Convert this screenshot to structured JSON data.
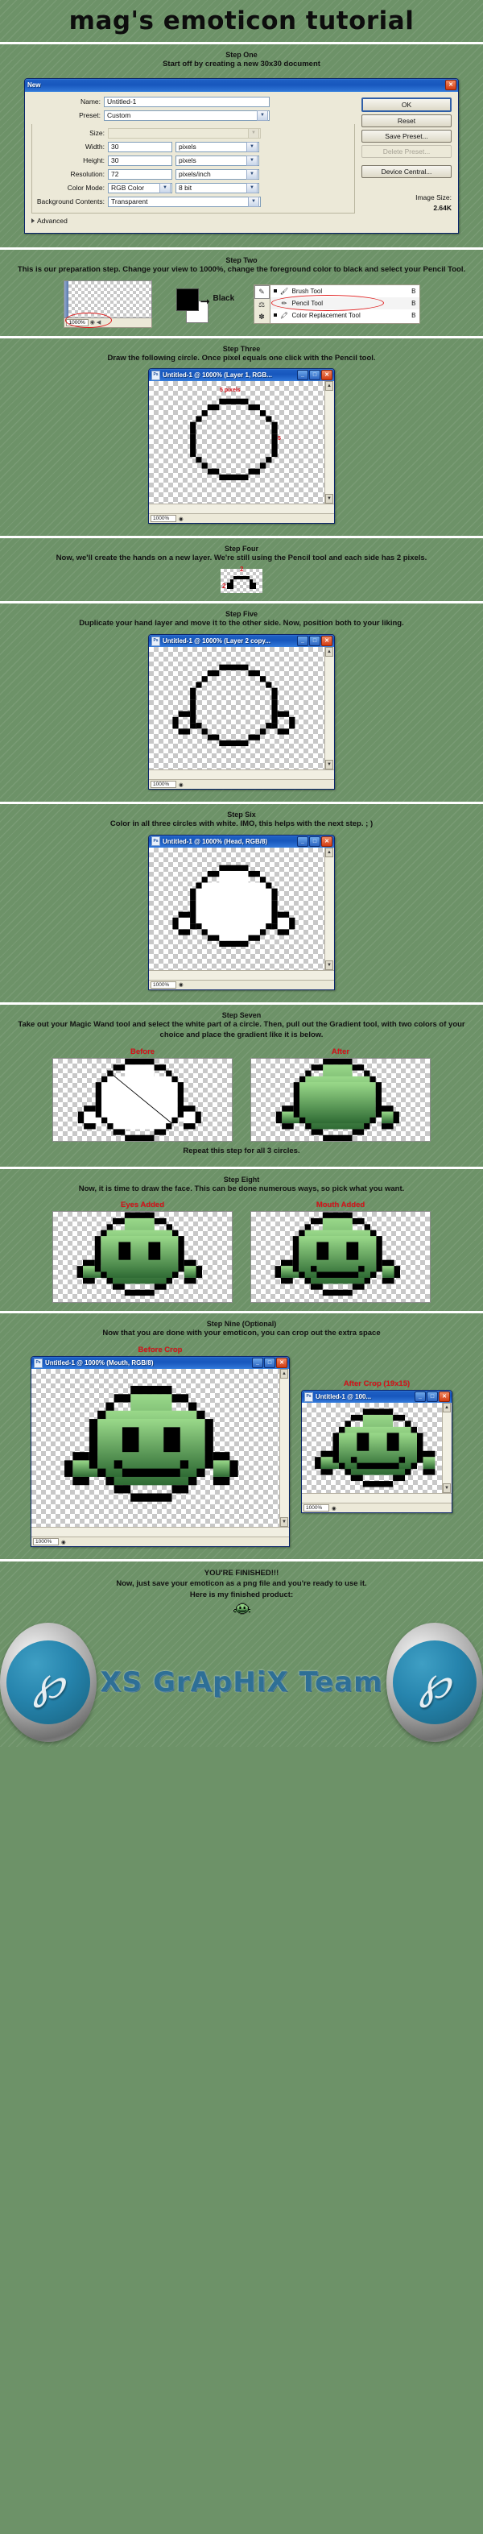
{
  "header": {
    "title": "mag's emoticon tutorial"
  },
  "steps": [
    {
      "id": "step-one",
      "title": "Step One",
      "desc": "Start off by creating a new 30x30 document",
      "dialog": {
        "title": "New",
        "close_label": "✕",
        "fields": {
          "name_label": "Name:",
          "name_value": "Untitled-1",
          "preset_label": "Preset:",
          "preset_value": "Custom",
          "size_label": "Size:",
          "size_value": "",
          "width_label": "Width:",
          "width_value": "30",
          "width_unit": "pixels",
          "height_label": "Height:",
          "height_value": "30",
          "height_unit": "pixels",
          "resolution_label": "Resolution:",
          "resolution_value": "72",
          "resolution_unit": "pixels/inch",
          "colormode_label": "Color Mode:",
          "colormode_value": "RGB Color",
          "colordepth_value": "8 bit",
          "bgcontents_label": "Background Contents:",
          "bgcontents_value": "Transparent",
          "advanced_label": "Advanced"
        },
        "buttons": {
          "ok": "OK",
          "reset": "Reset",
          "save_preset": "Save Preset...",
          "delete_preset": "Delete Preset...",
          "device_central": "Device Central..."
        },
        "image_size_label": "Image Size:",
        "image_size_value": "2.64K"
      }
    },
    {
      "id": "step-two",
      "title": "Step Two",
      "desc": "This is our preparation step.  Change your view to 1000%, change the foreground color to black and select your Pencil Tool.",
      "zoom_value": "1000%",
      "swatch_label": "Black",
      "tools": [
        {
          "label": "Brush Tool",
          "key": "B",
          "selected": false
        },
        {
          "label": "Pencil Tool",
          "key": "B",
          "selected": true
        },
        {
          "label": "Color Replacement Tool",
          "key": "B",
          "selected": false
        }
      ]
    },
    {
      "id": "step-three",
      "title": "Step Three",
      "desc": "Draw the following circle.  Once pixel equals one click with the Pencil tool.",
      "window_title": "Untitled-1 @ 1000% (Layer 1, RGB...",
      "zoom_value": "1000%",
      "annotation_top": "5 pixels",
      "annotation_right": "5"
    },
    {
      "id": "step-four",
      "title": "Step Four",
      "desc": "Now, we'll create the hands on a new layer.  We're still using the Pencil tool and each side has 2 pixels.",
      "annotation_top": "2",
      "annotation_left": "2"
    },
    {
      "id": "step-five",
      "title": "Step Five",
      "desc": "Duplicate your hand layer and move it to the other side.  Now, position both to your liking.",
      "window_title": "Untitled-1 @ 1000% (Layer 2 copy...",
      "zoom_value": "1000%"
    },
    {
      "id": "step-six",
      "title": "Step Six",
      "desc": "Color in all three circles with white.  IMO, this helps with the next step. ; )",
      "window_title": "Untitled-1 @ 1000% (Head, RGB/8)",
      "zoom_value": "1000%"
    },
    {
      "id": "step-seven",
      "title": "Step Seven",
      "desc": "Take out your Magic Wand tool and select the white part of a circle.  Then, pull out the Gradient tool, with two colors of your choice and place the gradient like it is below.",
      "before_label": "Before",
      "after_label": "After",
      "footnote": "Repeat this step for all 3 circles."
    },
    {
      "id": "step-eight",
      "title": "Step Eight",
      "desc": "Now, it is time to draw the face.  This can be done numerous ways, so pick what you want.",
      "eyes_label": "Eyes Added",
      "mouth_label": "Mouth Added"
    },
    {
      "id": "step-nine",
      "title": "Step Nine (Optional)",
      "desc": "Now that you are done with your emoticon, you can crop out the extra space",
      "before_crop_label": "Before Crop",
      "after_crop_label": "After Crop (19x15)",
      "window_title_before": "Untitled-1 @ 1000% (Mouth, RGB/8)",
      "window_title_after": "Untitled-1 @ 100...",
      "zoom_value": "1000%"
    }
  ],
  "footer": {
    "line1": "YOU'RE FINISHED!!!",
    "line2": "Now, just save your emoticon as a png file and you're ready to use it.",
    "line3": "Here is my finished product:",
    "brand": "XS GrApHiX Team",
    "logo_glyph": "℘"
  },
  "colors": {
    "background": "#6d9268",
    "accent_red": "#d8121a",
    "titlebar_blue": "#1757bd",
    "brand_blue": "#2e6f96",
    "emoticon_green_light": "#8fd17a",
    "emoticon_green_dark": "#2f6b34"
  }
}
